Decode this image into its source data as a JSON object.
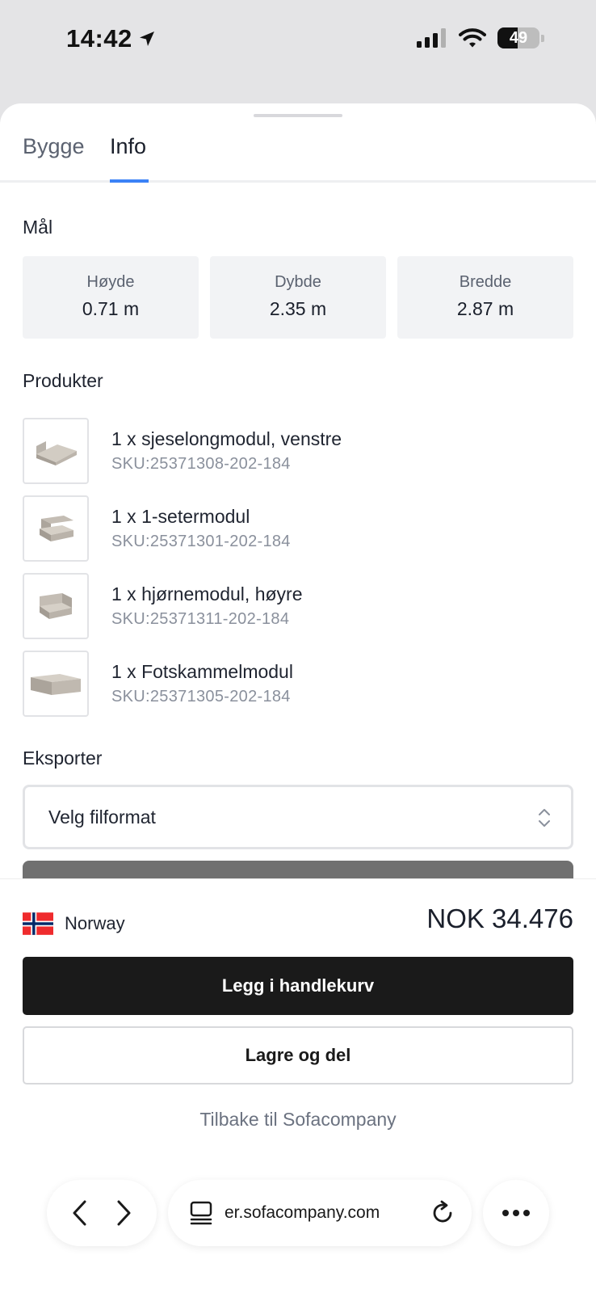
{
  "status_bar": {
    "time": "14:42",
    "battery": "49"
  },
  "tabs": [
    {
      "label": "Bygge",
      "active": false
    },
    {
      "label": "Info",
      "active": true
    }
  ],
  "dimensions": {
    "title": "Mål",
    "items": [
      {
        "label": "Høyde",
        "value": "0.71 m"
      },
      {
        "label": "Dybde",
        "value": "2.35 m"
      },
      {
        "label": "Bredde",
        "value": "2.87 m"
      }
    ]
  },
  "products": {
    "title": "Produkter",
    "items": [
      {
        "name": "1 x sjeselongmodul, venstre",
        "sku": "SKU:25371308-202-184",
        "icon": "chaise-module-icon"
      },
      {
        "name": "1 x 1-setermodul",
        "sku": "SKU:25371301-202-184",
        "icon": "one-seater-module-icon"
      },
      {
        "name": "1 x hjørnemodul, høyre",
        "sku": "SKU:25371311-202-184",
        "icon": "corner-module-icon"
      },
      {
        "name": "1 x Fotskammelmodul",
        "sku": "SKU:25371305-202-184",
        "icon": "footstool-module-icon"
      }
    ]
  },
  "export": {
    "title": "Eksporter",
    "select_value": "Velg filformat"
  },
  "footer": {
    "country": "Norway",
    "price": "NOK 34.476",
    "cart_label": "Legg i handlekurv",
    "save_label": "Lagre og del",
    "back_label": "Tilbake til Sofacompany"
  },
  "browser": {
    "url": "er.sofacompany.com"
  },
  "colors": {
    "accent": "#3b82f6",
    "primary_button": "#1a1a1a",
    "muted_text": "#6b7280",
    "card_bg": "#f2f3f5"
  }
}
